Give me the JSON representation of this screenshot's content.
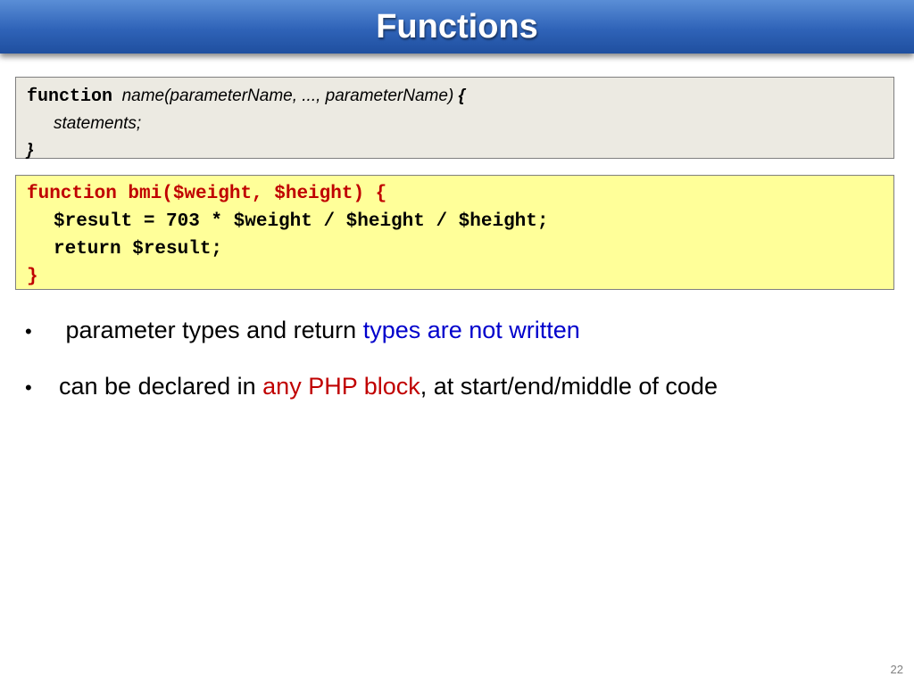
{
  "title": "Functions",
  "syntax": {
    "keyword": "function",
    "signature": "name(parameterName, ..., parameterName)",
    "open_brace": "{",
    "body": "statements;",
    "close_brace": "}"
  },
  "code": {
    "line1": "function bmi($weight, $height) {",
    "line2": "$result = 703 * $weight / $height / $height;",
    "line3": "return $result;",
    "line4": "}"
  },
  "bullets": [
    {
      "marker": "•",
      "text_before": "parameter types and return ",
      "highlight": "types are not written",
      "text_after": ""
    },
    {
      "marker": "•",
      "text_before": "can be declared in ",
      "highlight": "any PHP block",
      "text_after": ", at start/end/middle of code"
    }
  ],
  "page_number": "22",
  "colors": {
    "title_bar": "#2f63b8",
    "syntax_bg": "#eceae2",
    "code_bg": "#ffff99",
    "code_red": "#c00000",
    "highlight_blue": "#0000cc",
    "highlight_red": "#c00000"
  }
}
